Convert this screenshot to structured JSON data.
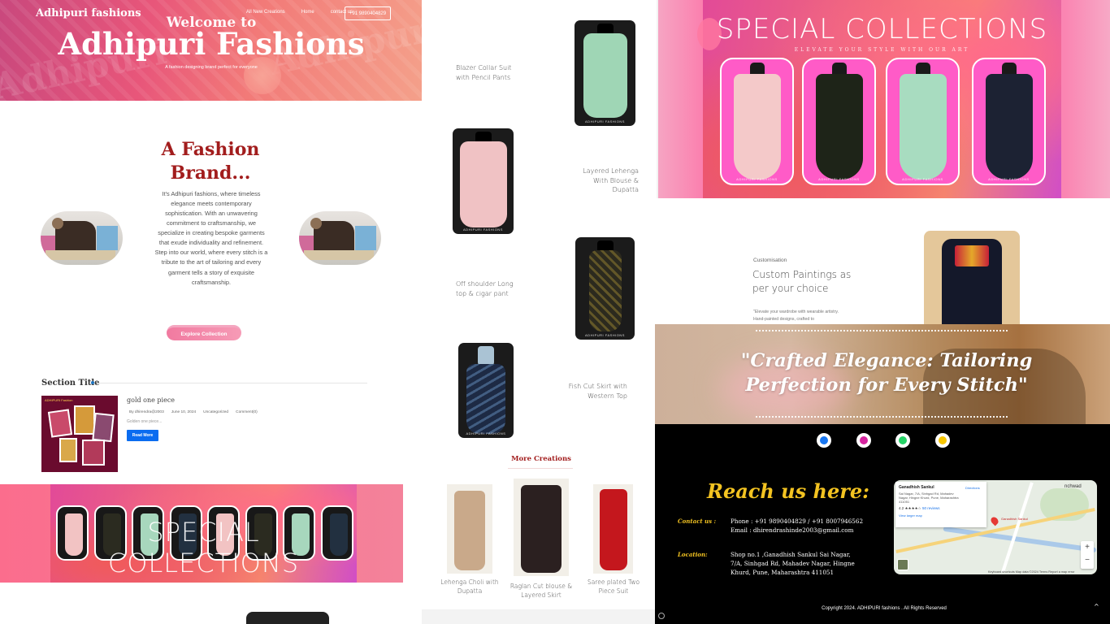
{
  "hero": {
    "brand": "Adhipuri fashions",
    "nav": [
      "All New Creations",
      "Home",
      "contact us"
    ],
    "phone": "+91 9890404829",
    "welcome": "Welcome to",
    "title": "Adhipuri Fashions",
    "subtitle": "A fashion designing brand perfect for everyone",
    "watermark": "Adhipuri"
  },
  "brand_section": {
    "heading": "A Fashion Brand...",
    "text": "It's Adhipuri fashions, where timeless elegance meets contemporary sophistication. With an unwavering commitment to craftsmanship, we specialize in creating bespoke garments that exude individuality and refinement. Step into our world, where every stitch is a tribute to the art of tailoring and every garment tells a story of exquisite craftsmanship.",
    "button": "Explore Collection"
  },
  "blog": {
    "section_title": "Section Title",
    "post": {
      "title": "gold one piece",
      "author": "By dhirendra@2003",
      "date": "June 10, 2024",
      "category": "Uncategorized",
      "comments": "Comment(0)",
      "excerpt": "Golden one piece...",
      "read_more": "Read More",
      "thumb_caption": "ADHIPURI Fashion"
    }
  },
  "products": [
    {
      "label": "Blazer Collar Suit with Pencil Pants",
      "tag": "ADHIPURI FASHIONS",
      "color": "#9fd6b5"
    },
    {
      "label": "Layered Lehenga With Blouse & Dupatta",
      "tag": "ADHIPURI FASHIONS",
      "color": "#f0c2c4"
    },
    {
      "label": "Off shoulder Long top & cigar pant",
      "tag": "ADHIPURI FASHIONS",
      "color": "#2c2a1e"
    },
    {
      "label": "Fish Cut Skirt with Western Top",
      "tag": "ADHIPURI FASHIONS",
      "color": "#1d2a44"
    }
  ],
  "more_creations": {
    "title": "More Creations",
    "items": [
      {
        "label": "Lehenga Choli with Dupatta",
        "color": "#c9a98a"
      },
      {
        "label": "Raglan Cut blouse & Layered Skirt",
        "color": "#2b2020"
      },
      {
        "label": "Saree plated Two Piece Suit",
        "color": "#c4171d"
      }
    ]
  },
  "special_collections": {
    "title": "SPECIAL COLLECTIONS",
    "subtitle": "ELEVATE YOUR STYLE WITH OUR ART",
    "card_tag": "ADHIPURI FASHIONS",
    "card_colors": [
      "#f4c9c9",
      "#1e2418",
      "#a8dcc0",
      "#1c2233"
    ],
    "mini_colors": [
      "#f2c3c3",
      "#2b2b20",
      "#a7d7bd",
      "#223040",
      "#f2c3c3",
      "#2b2b20",
      "#a7d7bd",
      "#223040"
    ]
  },
  "customisation": {
    "kicker": "Customisation",
    "heading": "Custom Paintings as per your choice",
    "text": "\"Elevate your wardrobe with wearable artistry. Hand-painted designs, crafted to"
  },
  "quote": {
    "text": "\"Crafted Elegance: Tailoring Perfection for Every Stitch\""
  },
  "footer": {
    "social": [
      {
        "name": "facebook-icon",
        "color": "#1877f2"
      },
      {
        "name": "instagram-icon",
        "color": "#d6249f"
      },
      {
        "name": "whatsapp-icon",
        "color": "#25d366"
      },
      {
        "name": "snapchat-icon",
        "color": "#f7c600"
      }
    ],
    "reach_title": "Reach us here:",
    "contact_label": "Contact us :",
    "phone": "Phone : +91 9890404829 / +91 8007946562",
    "email": "Email : dhirendrashinde2003@gmail.com",
    "location_label": "Location:",
    "address": "Shop no.1 ,Ganadhish Sankul Sai Nagar, 7/A, Sinhgad Rd, Mahadev Nagar, Hingne Khurd, Pune, Maharashtra 411051",
    "copyright": "Copyright 2024. ADHIPURI fashions . All Rights Reserved"
  },
  "map": {
    "place": "Ganadhish Sankul",
    "address": "Sai Nagar, 7/A, Sinhgad Rd, Mahadev Nagar, Hingne Khurd, Pune, Maharashtra 411051",
    "rating": "4.2 ★★★★☆",
    "reviews": "50 reviews",
    "view_larger": "View larger map",
    "directions": "Directions",
    "pin_label": "Ganadhish Sankul",
    "town": "nchwad",
    "footer": "Keyboard shortcuts   Map data ©2024   Terms   Report a map error"
  }
}
